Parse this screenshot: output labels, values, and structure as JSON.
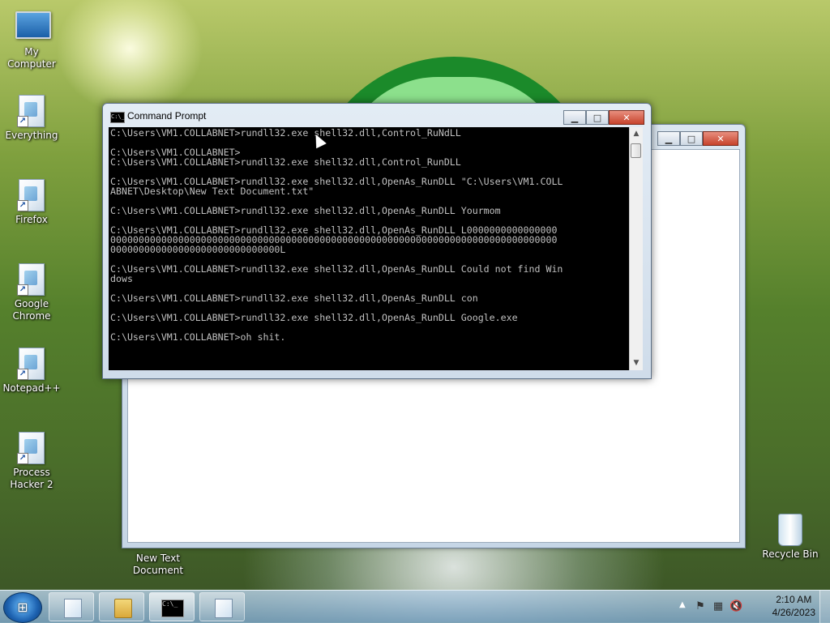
{
  "desktop": {
    "icons": [
      {
        "label": "My Computer",
        "icon": "computer-icon"
      },
      {
        "label": "Everything",
        "icon": "shortcut-file-icon"
      },
      {
        "label": "Firefox",
        "icon": "shortcut-file-icon"
      },
      {
        "label": "Google Chrome",
        "icon": "shortcut-file-icon"
      },
      {
        "label": "Notepad++",
        "icon": "shortcut-file-icon"
      },
      {
        "label": "Process Hacker 2",
        "icon": "shortcut-file-icon"
      },
      {
        "label": "New Text Document",
        "icon": "text-file-icon"
      },
      {
        "label": "Recycle Bin",
        "icon": "recycle-bin-icon"
      }
    ]
  },
  "cmd_window": {
    "title": "Command Prompt",
    "icon_text": "C:\\_",
    "lines": "C:\\Users\\VM1.COLLABNET>rundll32.exe shell32.dll,Control_RuNdLL\n\nC:\\Users\\VM1.COLLABNET>\nC:\\Users\\VM1.COLLABNET>rundll32.exe shell32.dll,Control_RunDLL\n\nC:\\Users\\VM1.COLLABNET>rundll32.exe shell32.dll,OpenAs_RunDLL \"C:\\Users\\VM1.COLL\nABNET\\Desktop\\New Text Document.txt\"\n\nC:\\Users\\VM1.COLLABNET>rundll32.exe shell32.dll,OpenAs_RunDLL Yourmom\n\nC:\\Users\\VM1.COLLABNET>rundll32.exe shell32.dll,OpenAs_RunDLL L0000000000000000\n0000000000000000000000000000000000000000000000000000000000000000000000000000000\n000000000000000000000000000000L\n\nC:\\Users\\VM1.COLLABNET>rundll32.exe shell32.dll,OpenAs_RunDLL Could not find Win\ndows\n\nC:\\Users\\VM1.COLLABNET>rundll32.exe shell32.dll,OpenAs_RunDLL con\n\nC:\\Users\\VM1.COLLABNET>rundll32.exe shell32.dll,OpenAs_RunDLL Google.exe\n\nC:\\Users\\VM1.COLLABNET>oh shit.",
    "buttons": {
      "minimize": "▁",
      "maximize": "□",
      "close": "✕"
    }
  },
  "background_window": {
    "buttons": {
      "minimize": "▁",
      "maximize": "□",
      "close": "✕"
    }
  },
  "taskbar": {
    "start_glyph": "⊞",
    "buttons": [
      {
        "icon": "notepad-icon"
      },
      {
        "icon": "folder-icon"
      },
      {
        "icon": "command-prompt-icon",
        "glyph": "C:\\_"
      },
      {
        "icon": "notepad-icon"
      }
    ],
    "tray": {
      "show_hidden_glyph": "▲",
      "icons": [
        "flag-icon",
        "network-icon",
        "volume-muted-icon"
      ],
      "time": "2:10 AM",
      "date": "4/26/2023"
    }
  }
}
